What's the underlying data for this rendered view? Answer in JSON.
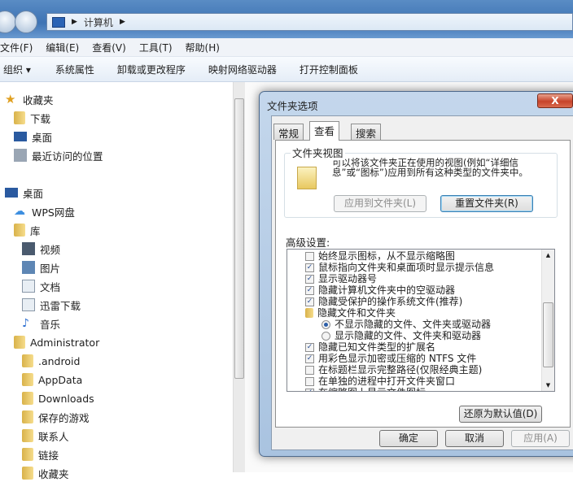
{
  "address": {
    "path": [
      "计算机"
    ]
  },
  "menu": [
    "文件(F)",
    "编辑(E)",
    "查看(V)",
    "工具(T)",
    "帮助(H)"
  ],
  "toolbar": [
    "组织 ▾",
    "系统属性",
    "卸载或更改程序",
    "映射网络驱动器",
    "打开控制面板"
  ],
  "sidebar": {
    "favorites": {
      "label": "收藏夹",
      "items": [
        "下载",
        "桌面",
        "最近访问的位置"
      ]
    },
    "desktop": {
      "label": "桌面",
      "items": [
        "WPS网盘",
        "库",
        "视频",
        "图片",
        "文档",
        "迅雷下载",
        "音乐",
        "Administrator",
        ".android",
        "AppData",
        "Downloads",
        "保存的游戏",
        "联系人",
        "链接",
        "收藏夹"
      ]
    }
  },
  "dialog": {
    "title": "文件夹选项",
    "close": "X",
    "tabs": [
      "常规",
      "查看",
      "搜索"
    ],
    "active_tab": "查看",
    "folder_views": {
      "label": "文件夹视图",
      "desc": "可以将该文件夹正在使用的视图(例如“详细信息”或“图标”)应用到所有这种类型的文件夹中。",
      "apply": "应用到文件夹(L)",
      "reset": "重置文件夹(R)"
    },
    "advanced_label": "高级设置:",
    "settings": [
      {
        "type": "checkbox",
        "checked": false,
        "label": "始终显示图标，从不显示缩略图"
      },
      {
        "type": "checkbox",
        "checked": true,
        "label": "鼠标指向文件夹和桌面项时显示提示信息"
      },
      {
        "type": "checkbox",
        "checked": true,
        "label": "显示驱动器号"
      },
      {
        "type": "checkbox",
        "checked": true,
        "label": "隐藏计算机文件夹中的空驱动器"
      },
      {
        "type": "checkbox",
        "checked": true,
        "label": "隐藏受保护的操作系统文件(推荐)"
      },
      {
        "type": "folder",
        "label": "隐藏文件和文件夹"
      },
      {
        "type": "radio",
        "checked": true,
        "label": "不显示隐藏的文件、文件夹或驱动器"
      },
      {
        "type": "radio",
        "checked": false,
        "label": "显示隐藏的文件、文件夹和驱动器"
      },
      {
        "type": "checkbox",
        "checked": true,
        "label": "隐藏已知文件类型的扩展名"
      },
      {
        "type": "checkbox",
        "checked": true,
        "label": "用彩色显示加密或压缩的 NTFS 文件"
      },
      {
        "type": "checkbox",
        "checked": false,
        "label": "在标题栏显示完整路径(仅限经典主题)"
      },
      {
        "type": "checkbox",
        "checked": false,
        "label": "在单独的进程中打开文件夹窗口"
      },
      {
        "type": "checkbox",
        "checked": true,
        "label": "在缩略图上显示文件图标"
      }
    ],
    "restore": "还原为默认值(D)",
    "ok": "确定",
    "cancel": "取消",
    "apply": "应用(A)"
  }
}
